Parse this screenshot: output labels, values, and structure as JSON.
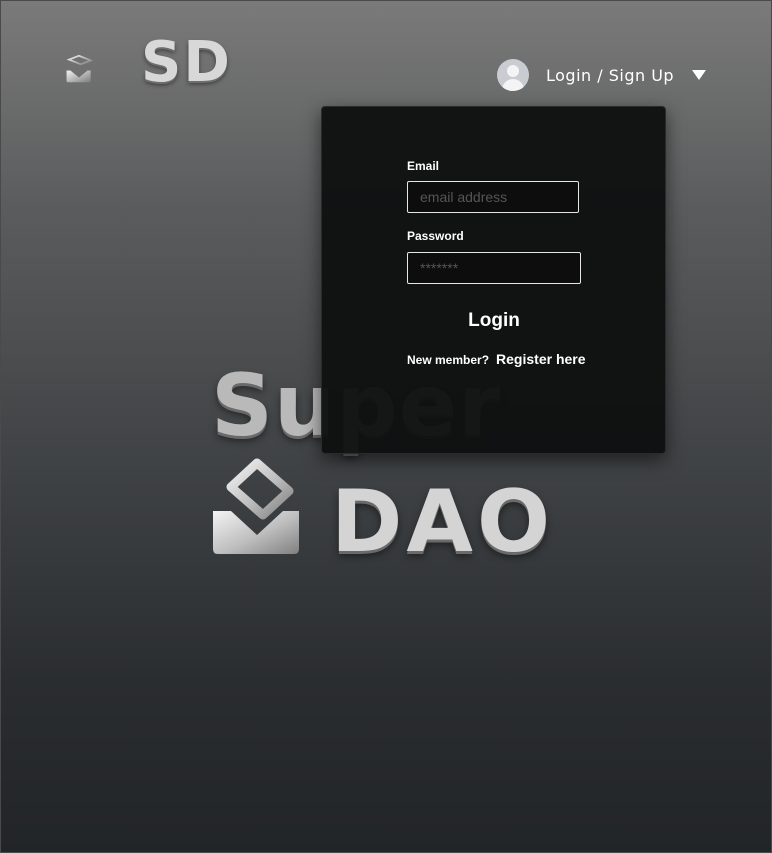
{
  "brand": {
    "short_name": "SD",
    "hero_line1": "Super",
    "hero_line2": "DAO",
    "logo_icon": "ballot-box-icon"
  },
  "header": {
    "user_menu_label": "Login / Sign Up",
    "avatar_icon": "user-avatar-icon",
    "dropdown_icon": "caret-down-icon"
  },
  "login_panel": {
    "email_label": "Email",
    "email_placeholder": "email address",
    "email_value": "",
    "password_label": "Password",
    "password_placeholder": "*******",
    "password_value": "",
    "login_button": "Login",
    "register_prompt": "New member?",
    "register_link": "Register here"
  },
  "colors": {
    "panel_bg": "#0f1010",
    "text": "#ffffff",
    "logo_metal": "#d8d8d8"
  }
}
